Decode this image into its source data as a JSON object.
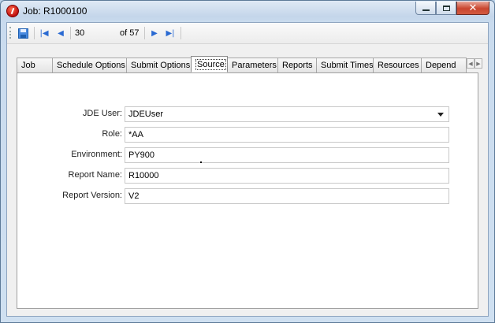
{
  "window": {
    "title": "Job: R1000100"
  },
  "toolbar": {
    "current_record": "30",
    "of_total": "of 57"
  },
  "tabs": [
    {
      "label": "Job"
    },
    {
      "label": "Schedule Options"
    },
    {
      "label": "Submit Options"
    },
    {
      "label": "Source"
    },
    {
      "label": "Parameters"
    },
    {
      "label": "Reports"
    },
    {
      "label": "Submit Times"
    },
    {
      "label": "Resources"
    },
    {
      "label": "Depend"
    }
  ],
  "active_tab": "Source",
  "form": {
    "jde_user": {
      "label": "JDE User:",
      "value": "JDEUser"
    },
    "role": {
      "label": "Role:",
      "value": "*AA"
    },
    "environment": {
      "label": "Environment:",
      "value": "PY900"
    },
    "report_name": {
      "label": "Report Name:",
      "value": "R10000"
    },
    "report_version": {
      "label": "Report Version:",
      "value": "V2"
    }
  },
  "icons": {
    "app": "jde-app-icon",
    "save": "save-icon",
    "first": "first-record-icon",
    "prev": "previous-record-icon",
    "next": "next-record-icon",
    "last": "last-record-icon"
  }
}
